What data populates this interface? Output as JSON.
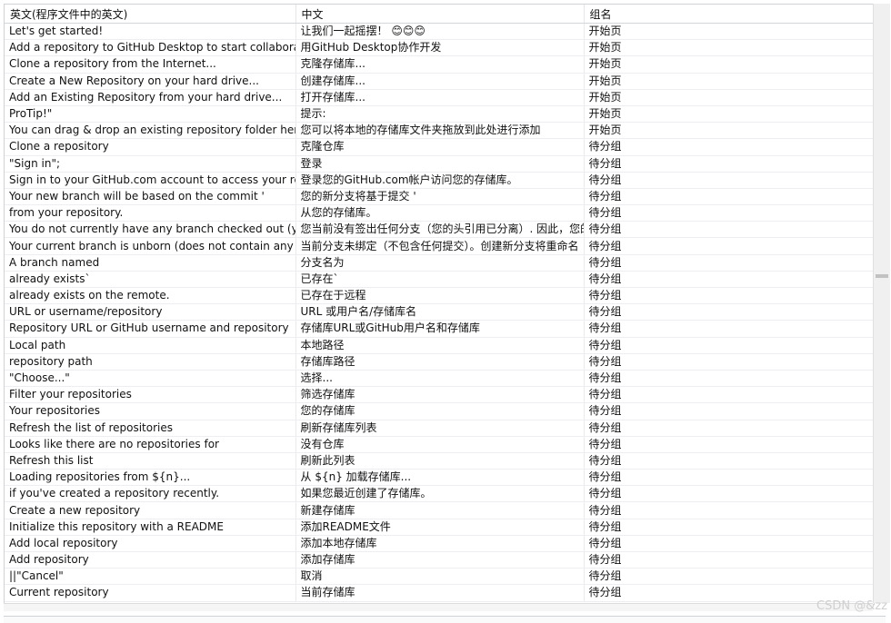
{
  "columns": [
    "英文(程序文件中的英文)",
    "中文",
    "组名"
  ],
  "rows": [
    [
      "Let's get started!",
      "让我们一起摇摆！ 😊😊😊",
      "开始页"
    ],
    [
      "Add a repository to GitHub Desktop to start collaborati",
      "用GitHub Desktop协作开发",
      "开始页"
    ],
    [
      "Clone a repository from the Internet...",
      "克隆存储库...",
      "开始页"
    ],
    [
      "Create a New Repository on your hard drive...",
      "创建存储库...",
      "开始页"
    ],
    [
      "Add an Existing Repository from your hard drive...",
      "打开存储库...",
      "开始页"
    ],
    [
      "ProTip!\"",
      "提示:",
      "开始页"
    ],
    [
      " You can drag & drop an existing repository folder here",
      "您可以将本地的存储库文件夹拖放到此处进行添加",
      "开始页"
    ],
    [
      "Clone a repository",
      "克隆仓库",
      "待分组"
    ],
    [
      "\"Sign in\";",
      "登录",
      "待分组"
    ],
    [
      "Sign in to your GitHub.com account to access your rep",
      "登录您的GitHub.com帐户访问您的存储库。",
      "待分组"
    ],
    [
      "Your new branch will be based on the commit '",
      "您的新分支将基于提交 '",
      "待分组"
    ],
    [
      "from your repository.",
      "从您的存储库。",
      "待分组"
    ],
    [
      "You do not currently have any branch checked out (yo",
      "您当前没有签出任何分支（您的头引用已分离）. 因此，您的",
      "待分组"
    ],
    [
      "Your current branch is unborn (does not contain any c",
      "当前分支未绑定（不包含任何提交）。创建新分支将重命名",
      "待分组"
    ],
    [
      "A branch named",
      "分支名为",
      "待分组"
    ],
    [
      "already exists`",
      "已存在`",
      "待分组"
    ],
    [
      "already exists on the remote.",
      "已存在于远程",
      "待分组"
    ],
    [
      "URL or username/repository",
      "URL 或用户名/存储库名",
      "待分组"
    ],
    [
      "Repository URL or GitHub username and repository",
      "存储库URL或GitHub用户名和存储库",
      "待分组"
    ],
    [
      "Local path",
      "本地路径",
      "待分组"
    ],
    [
      "repository path",
      "存储库路径",
      "待分组"
    ],
    [
      "\"Choose...\"",
      "选择...",
      "待分组"
    ],
    [
      "Filter your repositories",
      "筛选存储库",
      "待分组"
    ],
    [
      "Your repositories",
      "您的存储库",
      "待分组"
    ],
    [
      "Refresh the list of repositories",
      "刷新存储库列表",
      "待分组"
    ],
    [
      "Looks like there are no repositories for",
      "没有仓库",
      "待分组"
    ],
    [
      "Refresh this list",
      "刷新此列表",
      "待分组"
    ],
    [
      "Loading repositories from ${n}...",
      "从 ${n} 加载存储库...",
      "待分组"
    ],
    [
      "if you've created a repository recently.",
      "如果您最近创建了存储库。",
      "待分组"
    ],
    [
      "Create a new repository",
      "新建存储库",
      "待分组"
    ],
    [
      "Initialize this repository with a README",
      "添加README文件",
      "待分组"
    ],
    [
      "Add local repository",
      "添加本地存储库",
      "待分组"
    ],
    [
      "Add repository",
      "添加存储库",
      "待分组"
    ],
    [
      "||\"Cancel\"",
      "取消",
      "待分组"
    ],
    [
      "Current repository",
      "当前存储库",
      "待分组"
    ]
  ],
  "watermark": "CSDN @&zz"
}
